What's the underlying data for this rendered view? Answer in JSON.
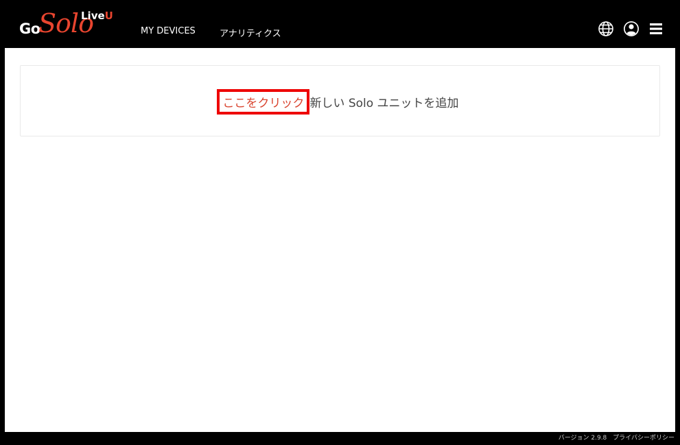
{
  "brand": {
    "go": "Go",
    "solo": "Solo",
    "live": "Live",
    "u": "U"
  },
  "nav": {
    "devices": "MY DEVICES",
    "analytics": "アナリティクス"
  },
  "icons": {
    "globe": "globe-icon",
    "user": "user-icon",
    "menu": "hamburger-menu-icon"
  },
  "main": {
    "add_link": "ここをクリック",
    "add_text": "新しい Solo ユニットを追加"
  },
  "footer": {
    "version": "バージョン 2.9.8",
    "privacy": "プライバシーポリシー"
  },
  "colors": {
    "accent": "#e8452f",
    "highlight_box": "#ee0000",
    "navbar_bg": "#000000"
  }
}
